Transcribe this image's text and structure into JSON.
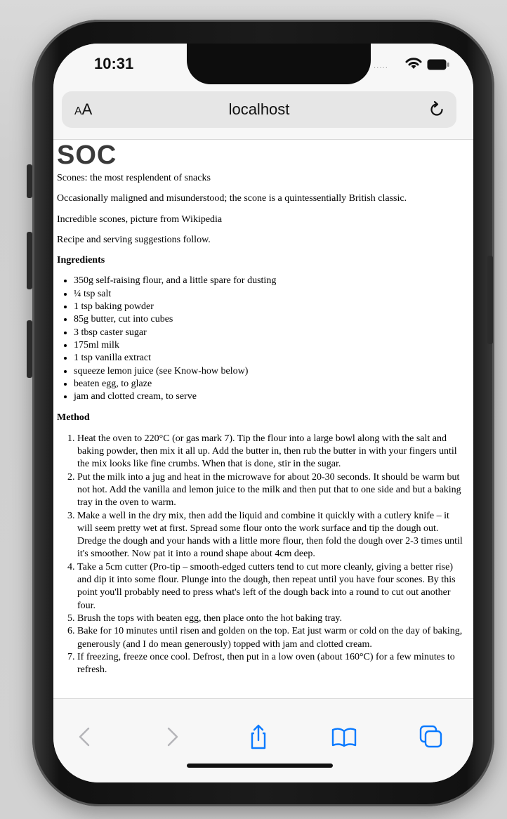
{
  "status_bar": {
    "time": "10:31",
    "signal_dots": "....."
  },
  "address_bar": {
    "text_size_small": "A",
    "text_size_big": "A",
    "url": "localhost"
  },
  "page": {
    "logo_text": "SOC",
    "intro": [
      "Scones: the most resplendent of snacks",
      "Occasionally maligned and misunderstood; the scone is a quintessentially British classic.",
      "Incredible scones, picture from Wikipedia",
      "Recipe and serving suggestions follow."
    ],
    "ingredients_heading": "Ingredients",
    "ingredients": [
      "350g self-raising flour, and a little spare for dusting",
      "¼ tsp salt",
      "1 tsp baking powder",
      "85g butter, cut into cubes",
      "3 tbsp caster sugar",
      "175ml milk",
      "1 tsp vanilla extract",
      "squeeze lemon juice (see Know-how below)",
      "beaten egg, to glaze",
      "jam and clotted cream, to serve"
    ],
    "method_heading": "Method",
    "method": [
      "Heat the oven to 220°C (or gas mark 7). Tip the flour into a large bowl along with the salt and baking powder, then mix it all up. Add the butter in, then rub the butter in with your fingers until the mix looks like fine crumbs. When that is done, stir in the sugar.",
      "Put the milk into a jug and heat in the microwave for about 20-30 seconds. It should be warm but not hot. Add the vanilla and lemon juice to the milk and then put that to one side and but a baking tray in the oven to warm.",
      "Make a well in the dry mix, then add the liquid and combine it quickly with a cutlery knife – it will seem pretty wet at first. Spread some flour onto the work surface and tip the dough out. Dredge the dough and your hands with a little more flour, then fold the dough over 2-3 times until it's smoother. Now pat it into a round shape about 4cm deep.",
      "Take a 5cm cutter (Pro-tip – smooth-edged cutters tend to cut more cleanly, giving a better rise) and dip it into some flour. Plunge into the dough, then repeat until you have four scones. By this point you'll probably need to press what's left of the dough back into a round to cut out another four.",
      "Brush the tops with beaten egg, then place onto the hot baking tray.",
      "Bake for 10 minutes until risen and golden on the top. Eat just warm or cold on the day of baking, generously (and I do mean generously) topped with jam and clotted cream.",
      "If freezing, freeze once cool. Defrost, then put in a low oven (about 160°C) for a few minutes to refresh."
    ]
  },
  "toolbar": {
    "icons": [
      "back-icon",
      "forward-icon",
      "share-icon",
      "bookmarks-icon",
      "tabs-icon"
    ]
  },
  "colors": {
    "accent": "#0a7aff",
    "disabled": "#b4b4b8"
  }
}
